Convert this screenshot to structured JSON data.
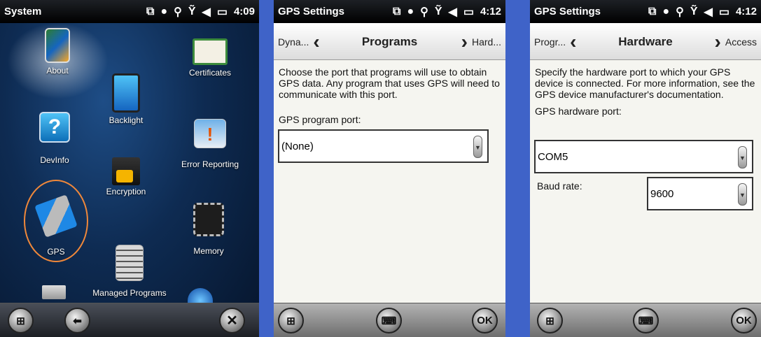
{
  "screen1": {
    "status_title": "System",
    "time": "4:09",
    "apps": [
      {
        "label": "About"
      },
      {
        "label": "Certificates"
      },
      {
        "label": "Backlight"
      },
      {
        "label": "DevInfo"
      },
      {
        "label": "Error Reporting"
      },
      {
        "label": "Encryption"
      },
      {
        "label": "GPS"
      },
      {
        "label": "Memory"
      },
      {
        "label": "Managed Programs"
      }
    ],
    "close_label": "✕"
  },
  "screen2": {
    "status_title": "GPS Settings",
    "time": "4:12",
    "nav_prev": "Dyna...",
    "nav_title": "Programs",
    "nav_next": "Hard...",
    "description": "Choose the port that programs will use to obtain GPS data. Any program that uses GPS will need to communicate with this port.",
    "port_label": "GPS program port:",
    "port_value": "(None)",
    "ok_label": "OK"
  },
  "screen3": {
    "status_title": "GPS Settings",
    "time": "4:12",
    "nav_prev": "Progr...",
    "nav_title": "Hardware",
    "nav_next": "Access",
    "description": "Specify the hardware port to which your GPS device is connected. For more information, see the GPS device manufacturer's documentation.",
    "port_label": "GPS hardware port:",
    "port_value": "COM5",
    "baud_label": "Baud rate:",
    "baud_value": "9600",
    "ok_label": "OK"
  },
  "colors": {
    "frame_blue": "#3f63c8",
    "highlight_orange": "#f0883a"
  }
}
